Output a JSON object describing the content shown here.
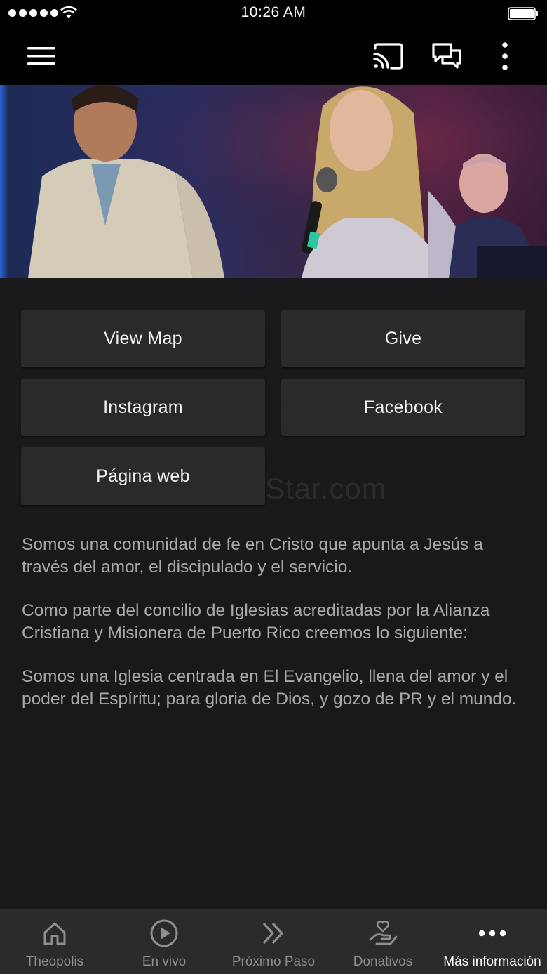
{
  "status_bar": {
    "time": "10:26 AM"
  },
  "app_bar": {
    "menu_icon": "hamburger-menu-icon",
    "cast_icon": "cast-icon",
    "chat_icon": "chat-bubbles-icon",
    "more_icon": "more-vertical-icon"
  },
  "hero": {
    "description": "banner photo"
  },
  "actions": {
    "view_map": "View Map",
    "give": "Give",
    "instagram": "Instagram",
    "facebook": "Facebook",
    "website": "Página web"
  },
  "watermark": "Star.com",
  "description": {
    "p1": "Somos una comunidad de fe en Cristo que apunta a Jesús a través del amor, el discipulado y el servicio.",
    "p2": "Como parte del concilio de Iglesias acreditadas por la Alianza Cristiana y Misionera de Puerto Rico creemos lo siguiente:",
    "p3": "Somos una Iglesia centrada en El Evangelio, llena del amor y el poder del Espíritu; para gloria de Dios, y gozo de PR y el mundo."
  },
  "tabs": [
    {
      "label": "Theopolis",
      "icon": "home-icon",
      "active": false
    },
    {
      "label": "En vivo",
      "icon": "play-circle-icon",
      "active": false
    },
    {
      "label": "Próximo Paso",
      "icon": "double-chevron-right-icon",
      "active": false
    },
    {
      "label": "Donativos",
      "icon": "heart-hand-icon",
      "active": false
    },
    {
      "label": "Más información",
      "icon": "more-horizontal-icon",
      "active": true
    }
  ],
  "colors": {
    "background": "#1c1c1e",
    "button": "#2a2a2c",
    "text": "#a9a9ad",
    "tab_inactive": "#8e8e93",
    "tab_active": "#ffffff"
  }
}
